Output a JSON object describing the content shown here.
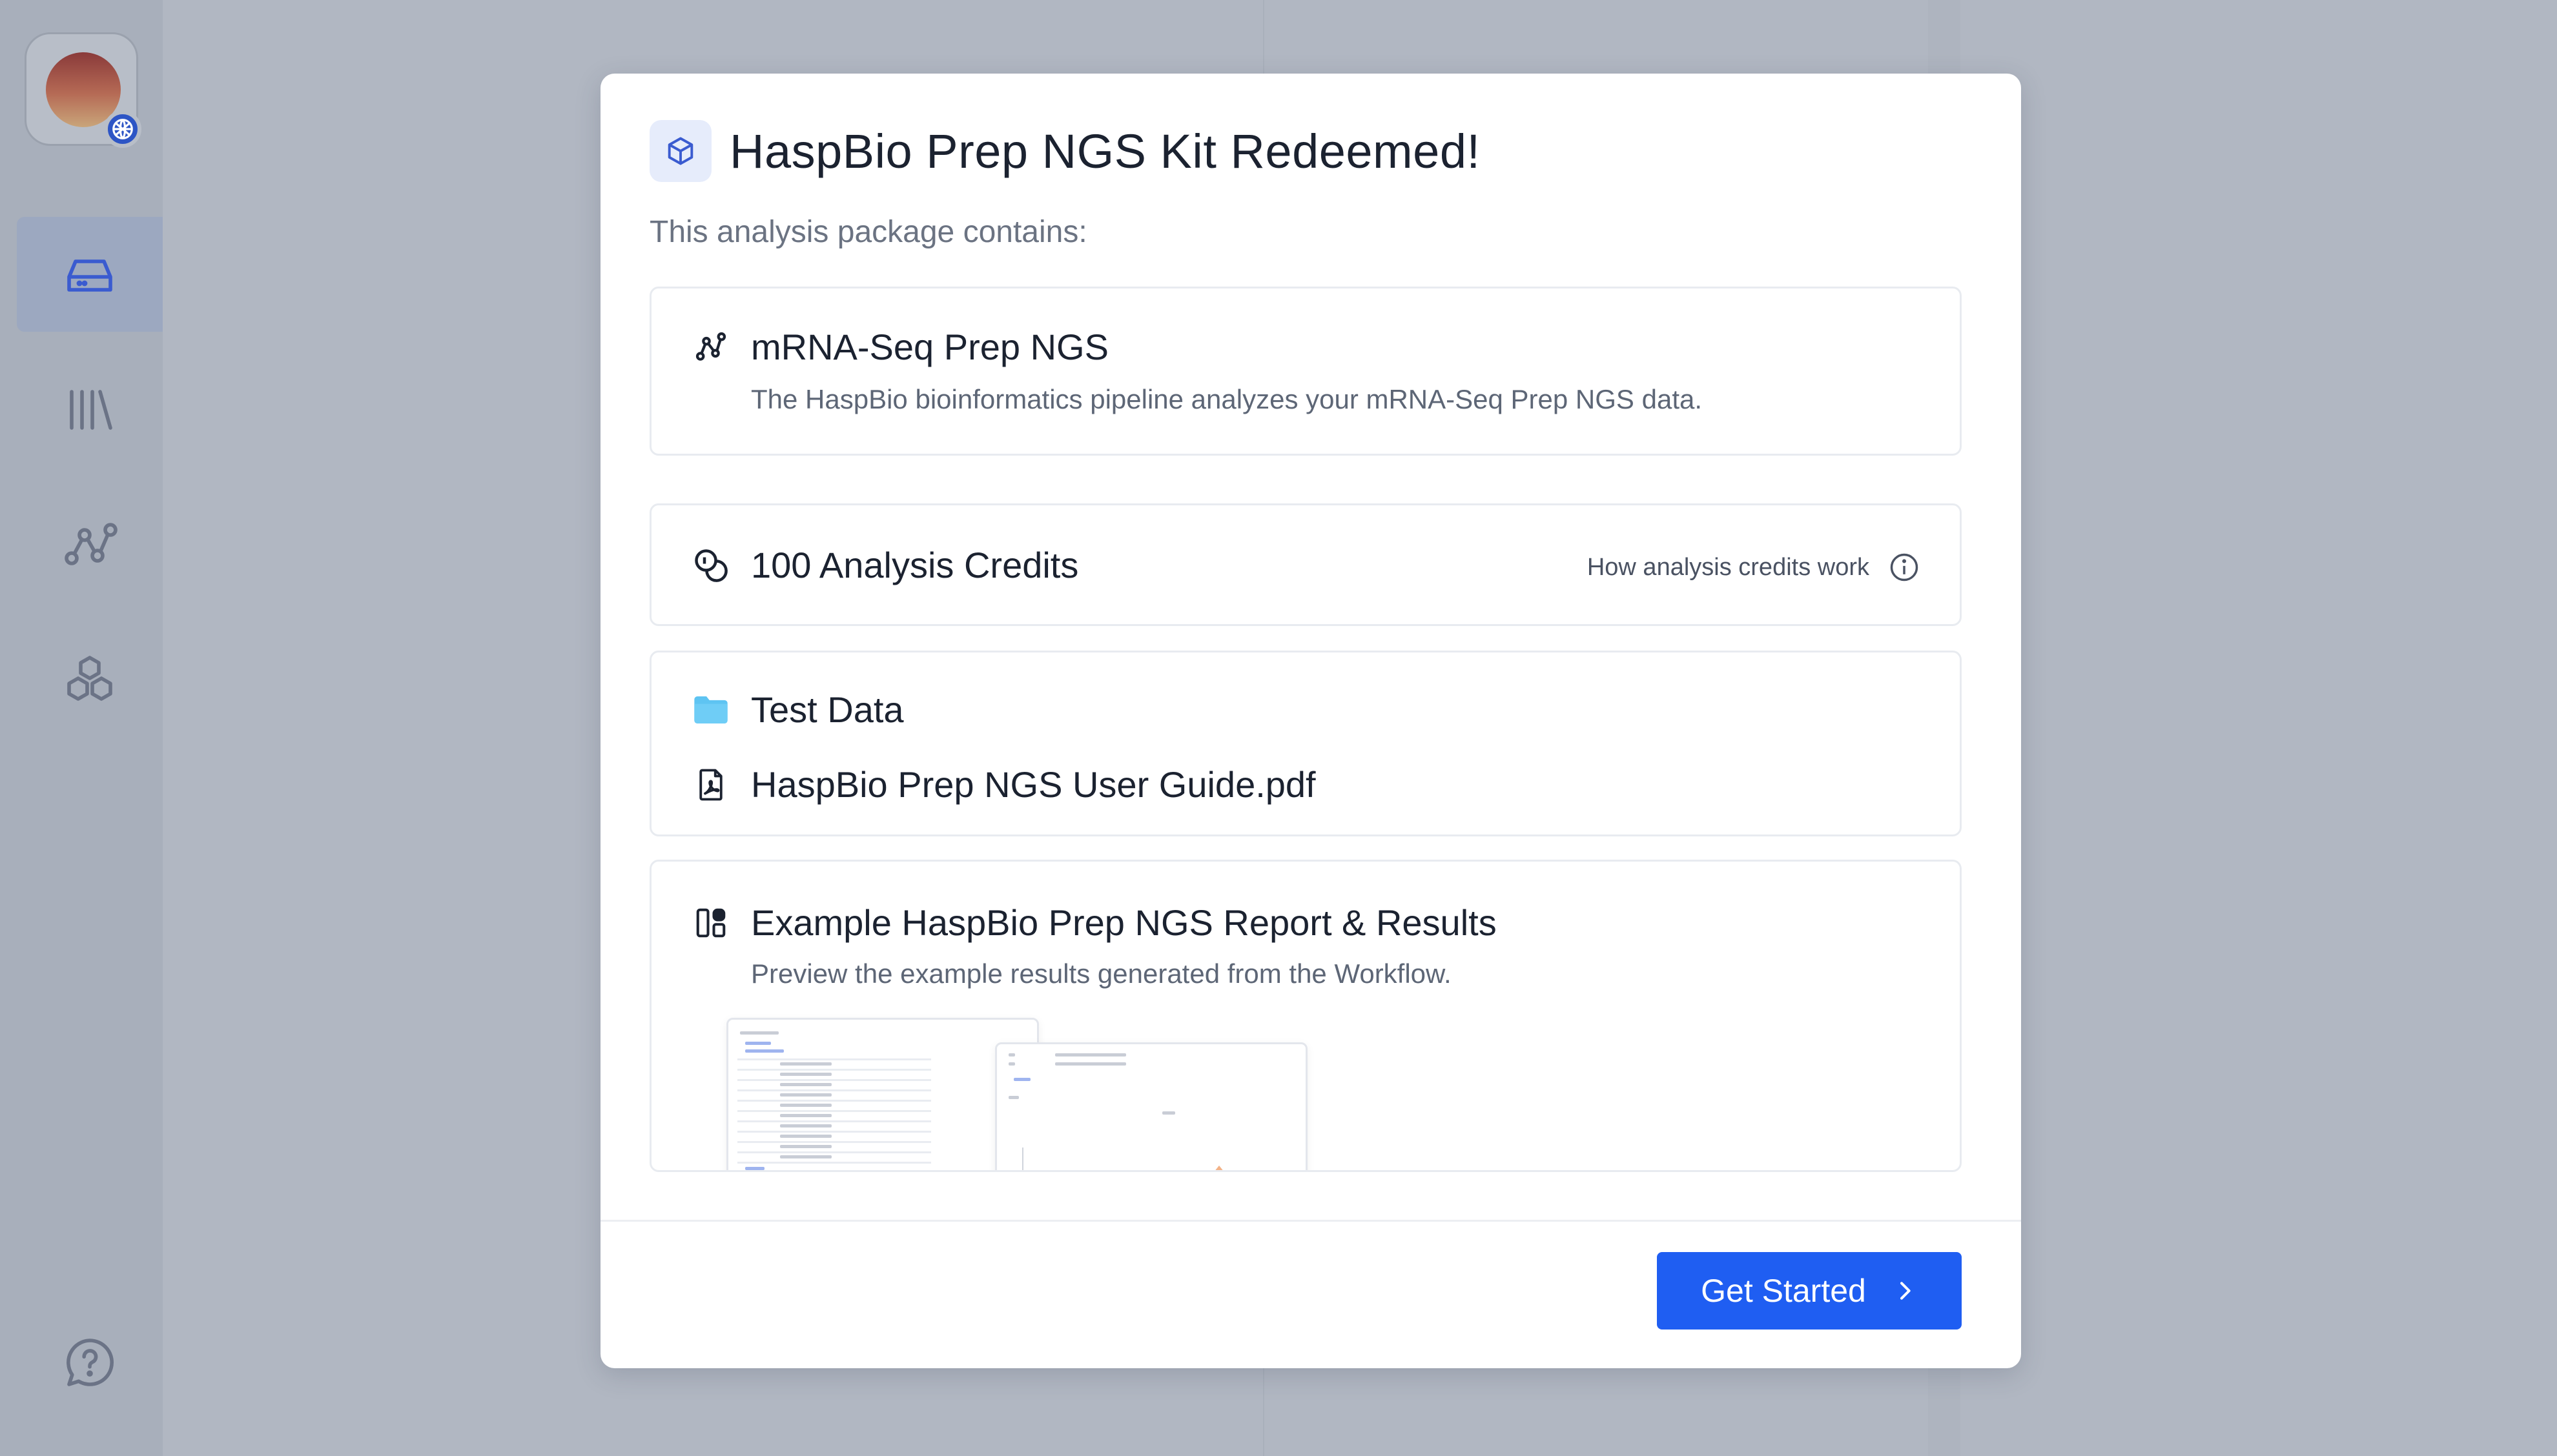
{
  "modal": {
    "title": "HaspBio Prep NGS Kit Redeemed!",
    "subtitle": "This analysis package contains:",
    "items": {
      "pipeline": {
        "title": "mRNA-Seq Prep NGS",
        "description": "The HaspBio bioinformatics pipeline analyzes your mRNA-Seq Prep NGS data."
      },
      "credits": {
        "title": "100 Analysis Credits",
        "help_link": "How analysis credits work"
      },
      "files": {
        "folder": "Test Data",
        "guide": "HaspBio Prep NGS User Guide.pdf"
      },
      "report": {
        "title": "Example HaspBio Prep NGS Report & Results",
        "description": "Preview the example results generated from the Workflow."
      }
    },
    "cta_label": "Get Started"
  },
  "colors": {
    "primary": "#1f5ef2",
    "folder": "#5ec4f2",
    "overlay": "#b1b7c2"
  },
  "icons": {
    "title": "package-icon",
    "pipeline": "workflow-icon",
    "credits": "coins-icon",
    "folder": "folder-icon",
    "pdf": "pdf-file-icon",
    "report": "dashboard-icon",
    "info": "info-icon",
    "cta": "chevron-right-icon"
  }
}
